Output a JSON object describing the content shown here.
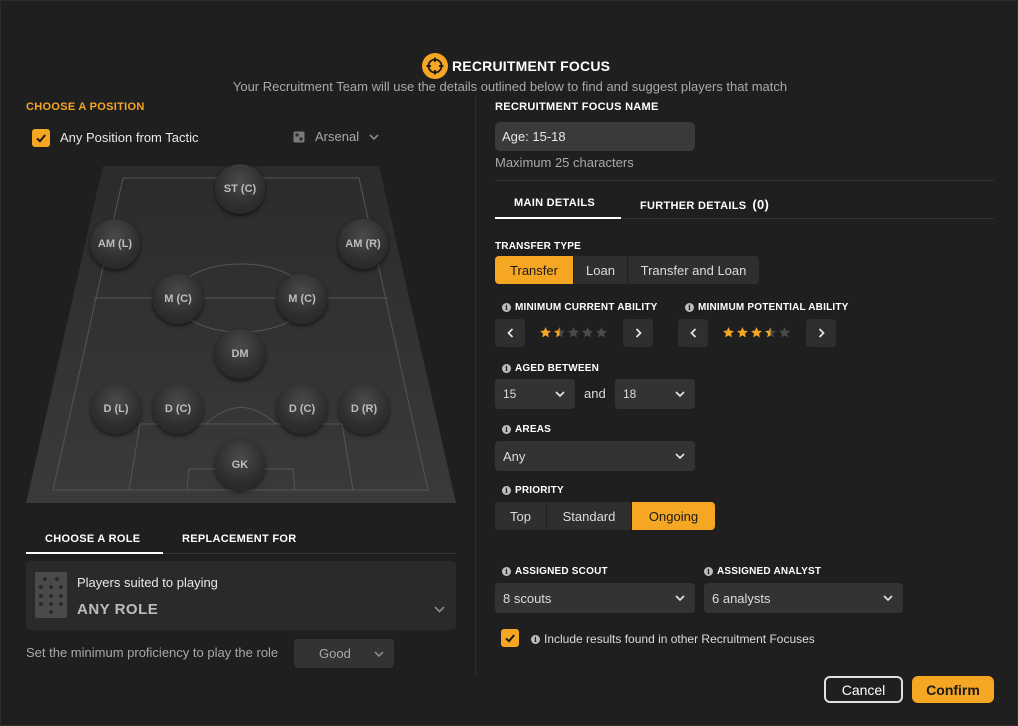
{
  "header": {
    "title": "RECRUITMENT FOCUS",
    "subtitle": "Your Recruitment Team will use the details outlined below to find and suggest players that match"
  },
  "left": {
    "choose_position_label": "CHOOSE A POSITION",
    "any_position_label": "Any Position from Tactic",
    "any_position_checked": true,
    "tactic_team": "Arsenal",
    "positions": [
      {
        "id": "st-c",
        "label": "ST (C)"
      },
      {
        "id": "am-l",
        "label": "AM (L)"
      },
      {
        "id": "am-r",
        "label": "AM (R)"
      },
      {
        "id": "m-c-left",
        "label": "M (C)"
      },
      {
        "id": "m-c-right",
        "label": "M (C)"
      },
      {
        "id": "dm",
        "label": "DM"
      },
      {
        "id": "d-l",
        "label": "D (L)"
      },
      {
        "id": "d-c-left",
        "label": "D (C)"
      },
      {
        "id": "d-c-right",
        "label": "D (C)"
      },
      {
        "id": "d-r",
        "label": "D (R)"
      },
      {
        "id": "gk",
        "label": "GK"
      }
    ],
    "tabs": [
      "CHOOSE A ROLE",
      "REPLACEMENT FOR"
    ],
    "active_tab": "CHOOSE A ROLE",
    "role_caption": "Players suited to playing",
    "role_value": "ANY ROLE",
    "proficiency_label": "Set the minimum proficiency to play the role",
    "proficiency_value": "Good"
  },
  "right": {
    "focus_name_label": "RECRUITMENT FOCUS NAME",
    "focus_name_value": "Age: 15-18",
    "focus_name_hint": "Maximum 25 characters",
    "tabs": {
      "main": "MAIN DETAILS",
      "further": "FURTHER DETAILS",
      "further_count": "(0)"
    },
    "transfer_type_label": "TRANSFER TYPE",
    "transfer_types": [
      "Transfer",
      "Loan",
      "Transfer and Loan"
    ],
    "transfer_type_selected": "Transfer",
    "min_current_ability_label": "MINIMUM CURRENT ABILITY",
    "min_current_ability_stars": 1.5,
    "min_potential_ability_label": "MINIMUM POTENTIAL ABILITY",
    "min_potential_ability_stars": 3.5,
    "aged_between_label": "AGED BETWEEN",
    "age_min": "15",
    "age_and": "and",
    "age_max": "18",
    "areas_label": "AREAS",
    "areas_value": "Any",
    "priority_label": "PRIORITY",
    "priorities": [
      "Top",
      "Standard",
      "Ongoing"
    ],
    "priority_selected": "Ongoing",
    "assigned_scout_label": "ASSIGNED SCOUT",
    "assigned_scout_value": "8 scouts",
    "assigned_analyst_label": "ASSIGNED ANALYST",
    "assigned_analyst_value": "6 analysts",
    "include_other_label": "Include results found in other Recruitment Focuses",
    "include_other_checked": true
  },
  "footer": {
    "cancel": "Cancel",
    "confirm": "Confirm"
  },
  "colors": {
    "accent": "#f5a623",
    "background": "#1f1f20",
    "panel": "#2a2a2b"
  }
}
